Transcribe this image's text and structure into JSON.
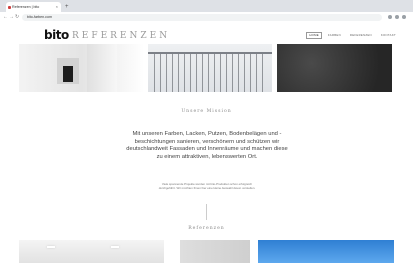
{
  "browser": {
    "tab_title": "Referenzen | bito",
    "new_tab": "+",
    "close": "×",
    "back": "←",
    "forward": "→",
    "reload": "↻",
    "url": "bito-farben.com"
  },
  "header": {
    "logo": "bito",
    "page_heading": "REFERENZEN",
    "menu": [
      {
        "label": "HOME",
        "active": true
      },
      {
        "label": "FARBEN"
      },
      {
        "label": "REFERENZEN"
      },
      {
        "label": "KONTAKT"
      }
    ]
  },
  "mission": {
    "title": "Unsere Mission",
    "text": "Mit unseren Farben, Lacken, Putzen, Bodenbelägen und -beschichtungen sanieren, verschönern und schützen wir deutschlandweit Fassaden und Innenräume und machen diese zu einem attraktiven, lebenswerten Ort.",
    "subtext": "Viele spannende Projekte wurden mit bito-Produkten schon erfolgreich durchgeführt. Wir möchten Ihnen hier eine kleine Auswahl davon vorstellen."
  },
  "references": {
    "title": "Referenzen"
  },
  "colors": {
    "accent": "#cf3d3d",
    "sky": "#2f7fd3"
  }
}
